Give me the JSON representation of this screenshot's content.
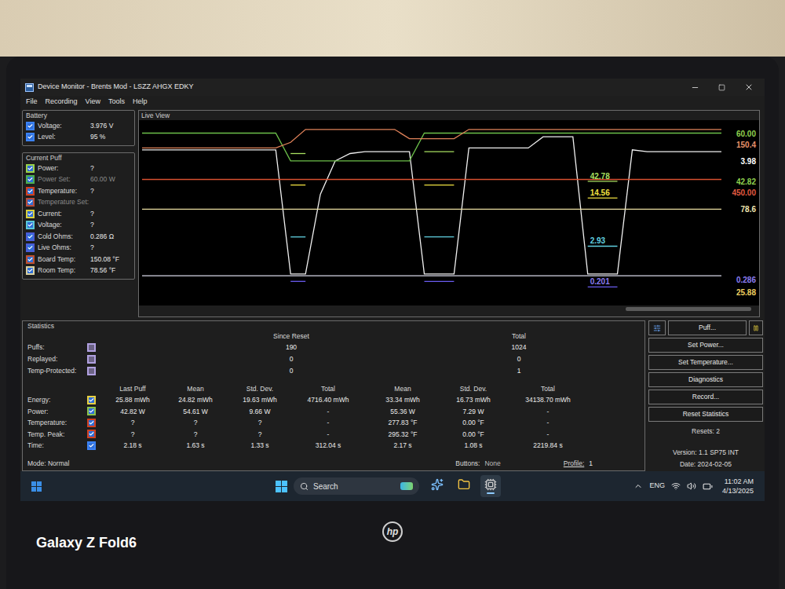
{
  "window": {
    "title": "Device Monitor - Brents Mod - LSZZ AHGX EDKY"
  },
  "menu": [
    "File",
    "Recording",
    "View",
    "Tools",
    "Help"
  ],
  "battery": {
    "title": "Battery",
    "rows": [
      {
        "label": "Voltage:",
        "value": "3.976 V",
        "checked": true,
        "disabled": false,
        "color": "#3b82f6"
      },
      {
        "label": "Level:",
        "value": "95 %",
        "checked": true,
        "disabled": false,
        "color": "#3b82f6"
      }
    ]
  },
  "current_puff": {
    "title": "Current Puff",
    "rows": [
      {
        "label": "Power:",
        "value": "?",
        "checked": true,
        "disabled": false,
        "color": "#9bd24a"
      },
      {
        "label": "Power Set:",
        "value": "60.00 W",
        "checked": true,
        "disabled": true,
        "color": "#4caf50"
      },
      {
        "label": "Temperature:",
        "value": "?",
        "checked": true,
        "disabled": false,
        "color": "#d04020"
      },
      {
        "label": "Temperature Set:",
        "value": "",
        "checked": true,
        "disabled": true,
        "color": "#b84c3c"
      },
      {
        "label": "Current:",
        "value": "?",
        "checked": true,
        "disabled": false,
        "color": "#d8d040"
      },
      {
        "label": "Voltage:",
        "value": "?",
        "checked": true,
        "disabled": false,
        "color": "#5bc8d8"
      },
      {
        "label": "Cold Ohms:",
        "value": "0.286 Ω",
        "checked": true,
        "disabled": false,
        "color": "#4a5cd8"
      },
      {
        "label": "Live Ohms:",
        "value": "?",
        "checked": true,
        "disabled": false,
        "color": "#4a5cd8"
      },
      {
        "label": "Board Temp:",
        "value": "150.08 °F",
        "checked": true,
        "disabled": false,
        "color": "#c05030"
      },
      {
        "label": "Room Temp:",
        "value": "78.56 °F",
        "checked": true,
        "disabled": false,
        "color": "#d8d0a0"
      }
    ]
  },
  "chart": {
    "title": "Live View",
    "series": [
      {
        "color": "#f0f0f0",
        "values": [
          84,
          84,
          84,
          84,
          84,
          84,
          84,
          84,
          84,
          84,
          17,
          17,
          60,
          78,
          82,
          83,
          83,
          83,
          83,
          17,
          17,
          17,
          85,
          85,
          85,
          85,
          85,
          91,
          91,
          91,
          17,
          17,
          17,
          84,
          83,
          83,
          83,
          83,
          83,
          83
        ]
      },
      {
        "color": "#6cc04a",
        "values": [
          93,
          93,
          93,
          93,
          93,
          93,
          93,
          93,
          93,
          93,
          78,
          78,
          78,
          78,
          78,
          78,
          78,
          78,
          78,
          93,
          93,
          93,
          93,
          93,
          93,
          93,
          93,
          93,
          93,
          93,
          93,
          93,
          93,
          93,
          93,
          93,
          93,
          93,
          93,
          93
        ]
      },
      {
        "color": "#e0825a",
        "values": [
          85,
          85,
          85,
          85,
          85,
          85,
          85,
          85,
          85,
          85,
          88,
          95,
          95,
          95,
          95,
          95,
          95,
          95,
          90,
          90,
          90,
          90,
          95,
          95,
          95,
          95,
          95,
          95,
          95,
          95,
          95,
          95,
          95,
          95,
          95,
          95,
          95,
          95,
          95,
          95
        ]
      },
      {
        "color": "#d85030",
        "values": [
          68,
          68,
          68,
          68,
          68,
          68,
          68,
          68,
          68,
          68,
          68,
          68,
          68,
          68,
          68,
          68,
          68,
          68,
          68,
          68,
          68,
          68,
          68,
          68,
          68,
          68,
          68,
          68,
          68,
          68,
          68,
          68,
          68,
          68,
          68,
          68,
          68,
          68,
          68,
          68
        ]
      },
      {
        "color": "#e8dca0",
        "values": [
          52,
          52,
          52,
          52,
          52,
          52,
          52,
          52,
          52,
          52,
          52,
          52,
          52,
          52,
          52,
          52,
          52,
          52,
          52,
          52,
          52,
          52,
          52,
          52,
          52,
          52,
          52,
          52,
          52,
          52,
          52,
          52,
          52,
          52,
          52,
          52,
          52,
          52,
          52,
          52
        ]
      },
      {
        "color": "#d8d8e8",
        "values": [
          16,
          16,
          16,
          16,
          16,
          16,
          16,
          16,
          16,
          16,
          16,
          16,
          16,
          16,
          16,
          16,
          16,
          16,
          16,
          16,
          16,
          16,
          16,
          16,
          16,
          16,
          16,
          16,
          16,
          16,
          16,
          16,
          16,
          16,
          16,
          16,
          16,
          16,
          16,
          16
        ]
      },
      {
        "color": "#a8e060",
        "values": [
          null,
          null,
          null,
          null,
          null,
          null,
          null,
          null,
          null,
          null,
          82,
          82,
          null,
          null,
          null,
          null,
          null,
          null,
          null,
          83,
          83,
          83,
          null,
          null,
          null,
          null,
          null,
          null,
          null,
          null,
          67,
          67,
          67,
          null,
          null,
          null,
          null,
          null,
          null,
          null
        ]
      },
      {
        "color": "#f0e040",
        "values": [
          null,
          null,
          null,
          null,
          null,
          null,
          null,
          null,
          null,
          null,
          65,
          65,
          null,
          null,
          null,
          null,
          null,
          null,
          null,
          65,
          65,
          65,
          null,
          null,
          null,
          null,
          null,
          null,
          null,
          null,
          58,
          58,
          58,
          null,
          null,
          null,
          null,
          null,
          null,
          null
        ]
      },
      {
        "color": "#60d0e0",
        "values": [
          null,
          null,
          null,
          null,
          null,
          null,
          null,
          null,
          null,
          null,
          37,
          37,
          null,
          null,
          null,
          null,
          null,
          null,
          null,
          37,
          37,
          37,
          null,
          null,
          null,
          null,
          null,
          null,
          null,
          null,
          32,
          32,
          32,
          null,
          null,
          null,
          null,
          null,
          null,
          null
        ]
      },
      {
        "color": "#6a5cf0",
        "values": [
          null,
          null,
          null,
          null,
          null,
          null,
          null,
          null,
          null,
          null,
          13,
          13,
          null,
          null,
          null,
          null,
          null,
          null,
          null,
          13,
          13,
          13,
          null,
          null,
          null,
          null,
          null,
          null,
          null,
          null,
          10,
          10,
          10,
          null,
          null,
          null,
          null,
          null,
          null,
          null
        ]
      }
    ],
    "edge_labels": [
      {
        "text": "60.00",
        "color": "#8fd14f",
        "value": 93
      },
      {
        "text": "150.4",
        "color": "#e8926a",
        "value": 87
      },
      {
        "text": "3.98",
        "color": "#ffffff",
        "value": 78
      },
      {
        "text": "42.82",
        "color": "#8fd14f",
        "value": 67
      },
      {
        "text": "450.00",
        "color": "#e05a40",
        "value": 61
      },
      {
        "text": "78.6",
        "color": "#f0e6b0",
        "value": 52
      },
      {
        "text": "0.286",
        "color": "#8a7cf0",
        "value": 14
      },
      {
        "text": "25.88",
        "color": "#f0d060",
        "value": 7
      }
    ],
    "puff_labels": [
      {
        "text": "42.78",
        "color": "#a8e060",
        "value": 67
      },
      {
        "text": "14.56",
        "color": "#f0e040",
        "value": 58
      },
      {
        "text": "2.93",
        "color": "#60d0e0",
        "value": 32
      },
      {
        "text": "0.201",
        "color": "#8a7cf0",
        "value": 10
      }
    ]
  },
  "statistics": {
    "title": "Statistics",
    "count_headers": [
      "Since Reset",
      "Total"
    ],
    "counts": [
      {
        "label": "Puffs:",
        "checked": false,
        "color": "#b0a0e0",
        "values": [
          "190",
          "1024"
        ]
      },
      {
        "label": "Replayed:",
        "checked": false,
        "color": "#b0a0e0",
        "values": [
          "0",
          "0"
        ]
      },
      {
        "label": "Temp-Protected:",
        "checked": false,
        "color": "#b0a0e0",
        "values": [
          "0",
          "1"
        ]
      }
    ],
    "columns": [
      "Last Puff",
      "Mean",
      "Std. Dev.",
      "Total",
      "Mean",
      "Std. Dev.",
      "Total"
    ],
    "rows": [
      {
        "label": "Energy:",
        "checked": true,
        "color": "#e8d040",
        "values": [
          "25.88 mWh",
          "24.82 mWh",
          "19.63 mWh",
          "4716.40 mWh",
          "33.34 mWh",
          "16.73 mWh",
          "34138.70 mWh"
        ]
      },
      {
        "label": "Power:",
        "checked": true,
        "color": "#8bc34a",
        "values": [
          "42.82 W",
          "54.61 W",
          "9.66 W",
          "-",
          "55.36 W",
          "7.29 W",
          "-"
        ]
      },
      {
        "label": "Temperature:",
        "checked": true,
        "color": "#d04020",
        "values": [
          "?",
          "?",
          "?",
          "-",
          "277.83 °F",
          "0.00 °F",
          "-"
        ]
      },
      {
        "label": "Temp. Peak:",
        "checked": true,
        "color": "#d04020",
        "values": [
          "?",
          "?",
          "?",
          "-",
          "295.32 °F",
          "0.00 °F",
          "-"
        ]
      },
      {
        "label": "Time:",
        "checked": true,
        "color": "#3b82f6",
        "values": [
          "2.18 s",
          "1.63 s",
          "1.33 s",
          "312.04 s",
          "2.17 s",
          "1.08 s",
          "2219.84 s"
        ]
      }
    ]
  },
  "status": {
    "mode": "Mode: Normal",
    "buttons_label": "Buttons:",
    "buttons_value": "None",
    "profile_label": "Profile:",
    "profile_value": "1"
  },
  "actions": {
    "puff": "Puff...",
    "buttons": [
      "Set Power...",
      "Set Temperature...",
      "Diagnostics",
      "Record...",
      "Reset Statistics"
    ],
    "resets": "Resets: 2",
    "version": "Version: 1.1 SP75 INT",
    "date": "Date: 2024-02-05"
  },
  "taskbar": {
    "search_placeholder": "Search",
    "pinned": [
      {
        "kind": "copilot",
        "selected": false
      },
      {
        "kind": "folder",
        "selected": false
      },
      {
        "kind": "app",
        "selected": true
      }
    ],
    "language": "ENG",
    "time": "11:02 AM",
    "date": "4/13/2025"
  },
  "photo": {
    "laptop_logo": "hp",
    "watermark": "Galaxy Z Fold6"
  }
}
